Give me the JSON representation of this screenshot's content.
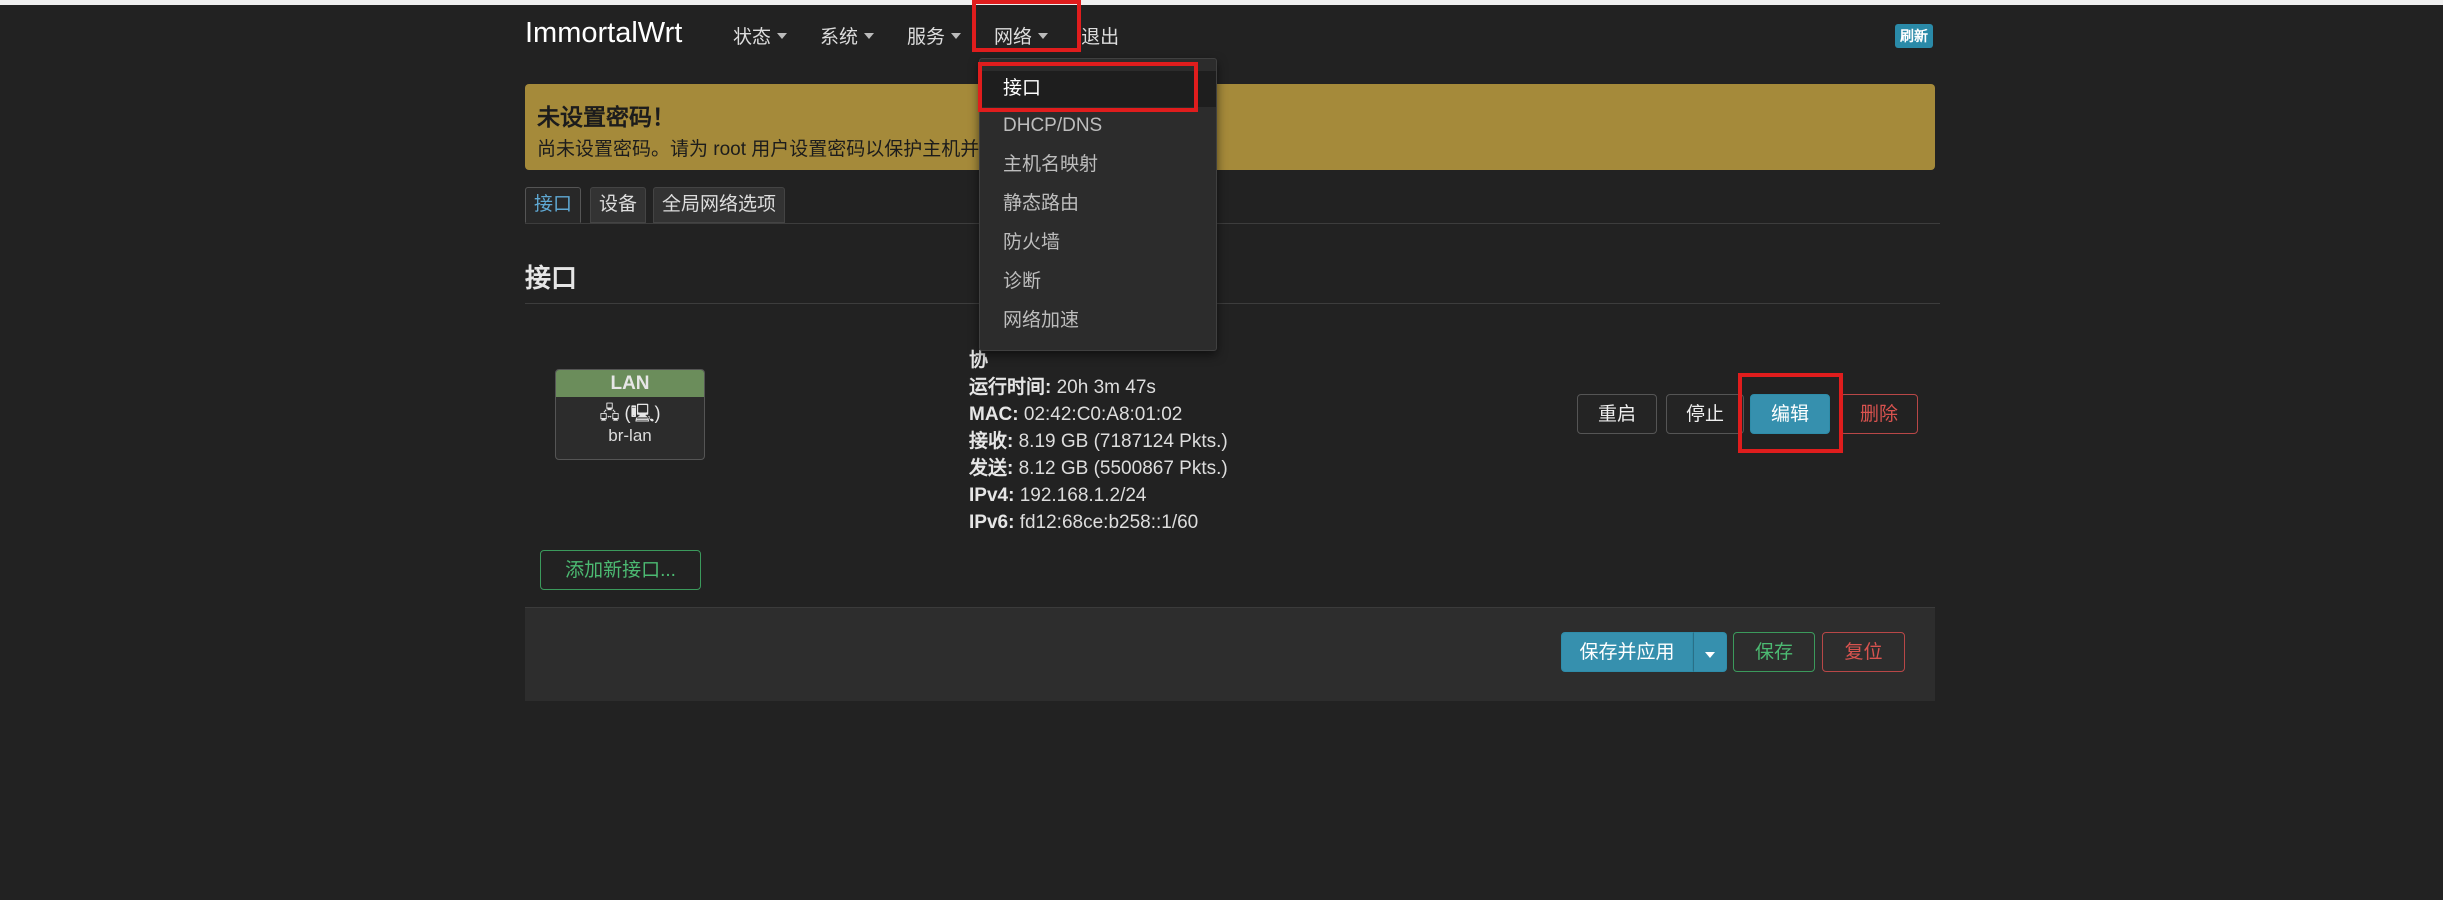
{
  "app": {
    "brand": "ImmortalWrt",
    "refresh_label": "刷新"
  },
  "nav": {
    "status": "状态",
    "system": "系统",
    "services": "服务",
    "network": "网络",
    "logout": "退出"
  },
  "banner": {
    "title": "未设置密码！",
    "text": "尚未设置密码。请为 root 用户设置密码以保护主机并"
  },
  "tabs": [
    "接口",
    "设备",
    "全局网络选项"
  ],
  "section": {
    "title": "接口"
  },
  "interface": {
    "name": "LAN",
    "icons": "🖧 (🖳)",
    "device": "br-lan",
    "partial_label": "协",
    "details": [
      {
        "label": "运行时间:",
        "value": "20h 3m 47s"
      },
      {
        "label": "MAC:",
        "value": "02:42:C0:A8:01:02"
      },
      {
        "label": "接收:",
        "value": "8.19 GB (7187124 Pkts.)"
      },
      {
        "label": "发送:",
        "value": "8.12 GB (5500867 Pkts.)"
      },
      {
        "label": "IPv4:",
        "value": "192.168.1.2/24"
      },
      {
        "label": "IPv6:",
        "value": "fd12:68ce:b258::1/60"
      }
    ],
    "buttons": {
      "restart": "重启",
      "stop": "停止",
      "edit": "编辑",
      "delete": "删除"
    }
  },
  "add_interface_label": "添加新接口...",
  "footer": {
    "save_apply": "保存并应用",
    "save": "保存",
    "reset": "复位"
  },
  "network_menu": [
    "接口",
    "DHCP/DNS",
    "主机名映射",
    "静态路由",
    "防火墙",
    "诊断",
    "网络加速"
  ],
  "colors": {
    "background": "#222222",
    "banner": "#a58a3a",
    "accent": "#3690ae",
    "highlight": "#e01d1d",
    "lan_header": "#6b8d5b"
  }
}
